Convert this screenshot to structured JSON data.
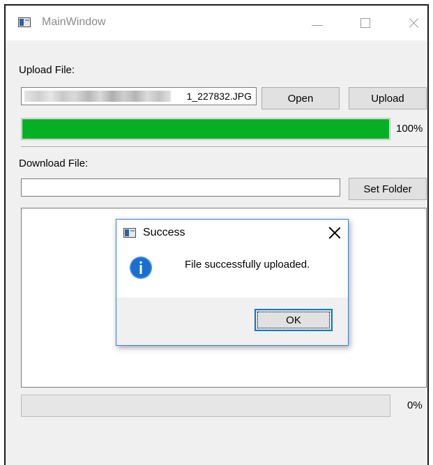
{
  "window": {
    "title": "MainWindow",
    "icon": "app-window-icon"
  },
  "upload": {
    "label": "Upload File:",
    "file_suffix": "1_227832.JPG",
    "open_label": "Open",
    "upload_label": "Upload",
    "progress": 1.0,
    "progress_text": "100%",
    "progress_color": "#06b025"
  },
  "download": {
    "label": "Download File:",
    "folder_value": "",
    "set_folder_label": "Set Folder",
    "progress": 0.0,
    "progress_text": "0%"
  },
  "dialog": {
    "title": "Success",
    "message": "File successfully uploaded.",
    "ok_label": "OK",
    "icon": "info-icon",
    "accent_color": "#0078d7"
  }
}
